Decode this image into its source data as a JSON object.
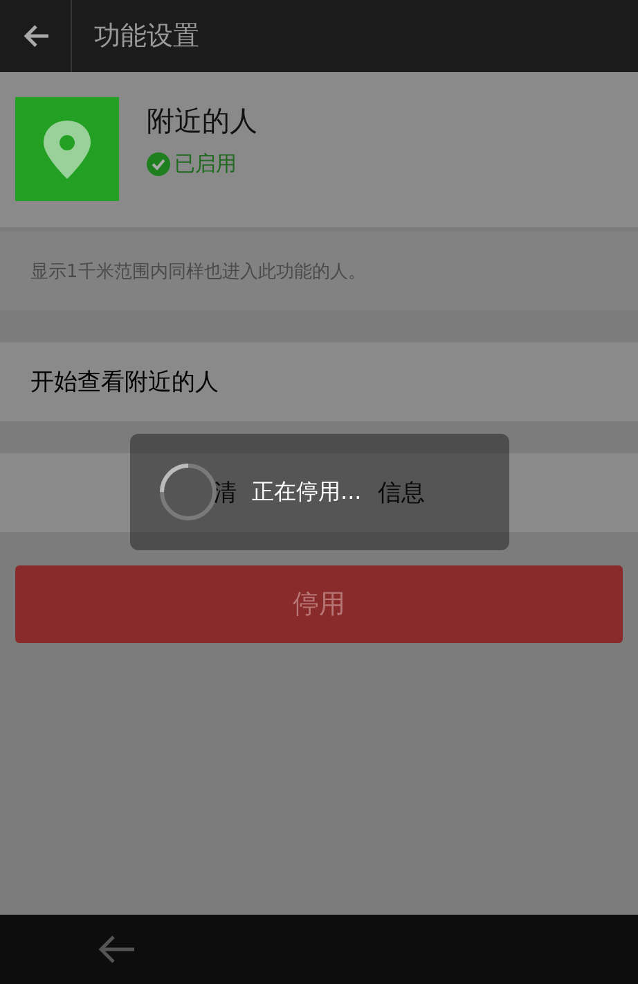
{
  "header": {
    "title": "功能设置"
  },
  "feature": {
    "name": "附近的人",
    "status": "已启用",
    "enabled": true
  },
  "description": "显示1千米范围内同样也进入此功能的人。",
  "actions": [
    {
      "label": "开始查看附近的人",
      "kind": "entry"
    },
    {
      "visible_parts": [
        "清",
        "信息"
      ],
      "kind": "centered"
    }
  ],
  "disable_button": "停用",
  "toast": {
    "message": "正在停用..."
  }
}
